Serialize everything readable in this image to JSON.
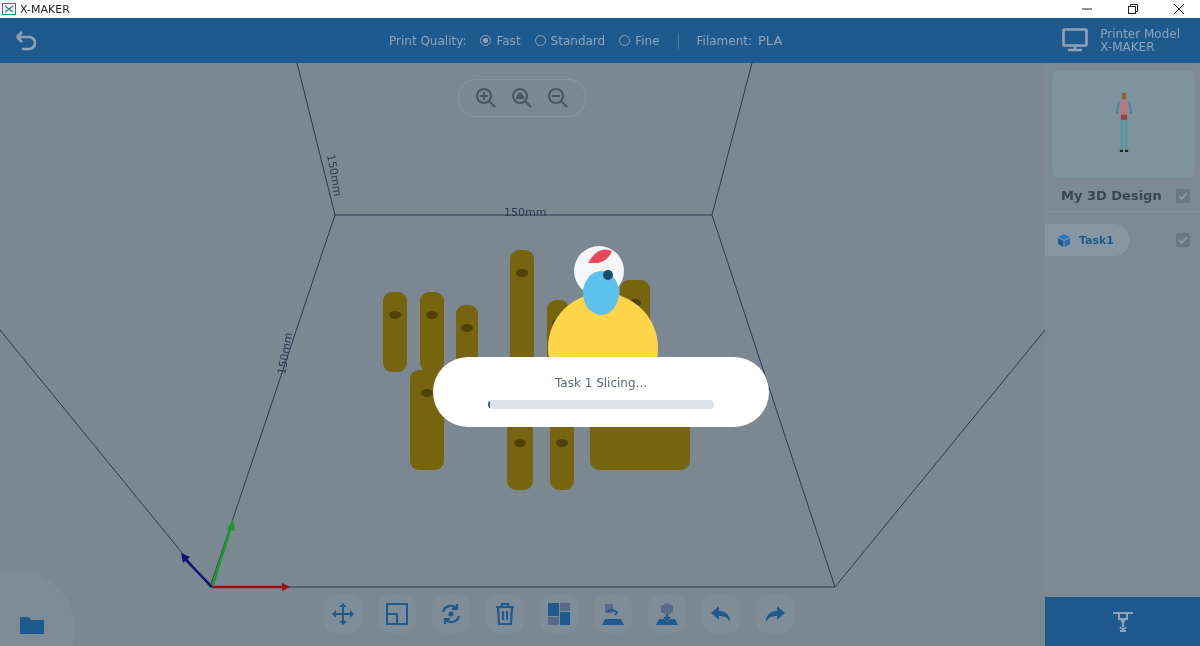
{
  "window": {
    "title": "X-MAKER"
  },
  "toolbar": {
    "print_quality_label": "Print Quality:",
    "qualities": [
      {
        "label": "Fast",
        "selected": true
      },
      {
        "label": "Standard",
        "selected": false
      },
      {
        "label": "Fine",
        "selected": false
      }
    ],
    "filament_label": "Filament:",
    "filament": "PLA",
    "printer_model_label": "Printer Model",
    "printer_model": "X-MAKER"
  },
  "viewport": {
    "dimension_labels": [
      "150mm",
      "150mm",
      "150mm"
    ]
  },
  "design": {
    "title": "My 3D Design",
    "checked": true,
    "tasks": [
      {
        "label": "Task1",
        "checked": true,
        "selected": true
      }
    ]
  },
  "dialog": {
    "message": "Task 1 Slicing...",
    "level": 0.01
  }
}
